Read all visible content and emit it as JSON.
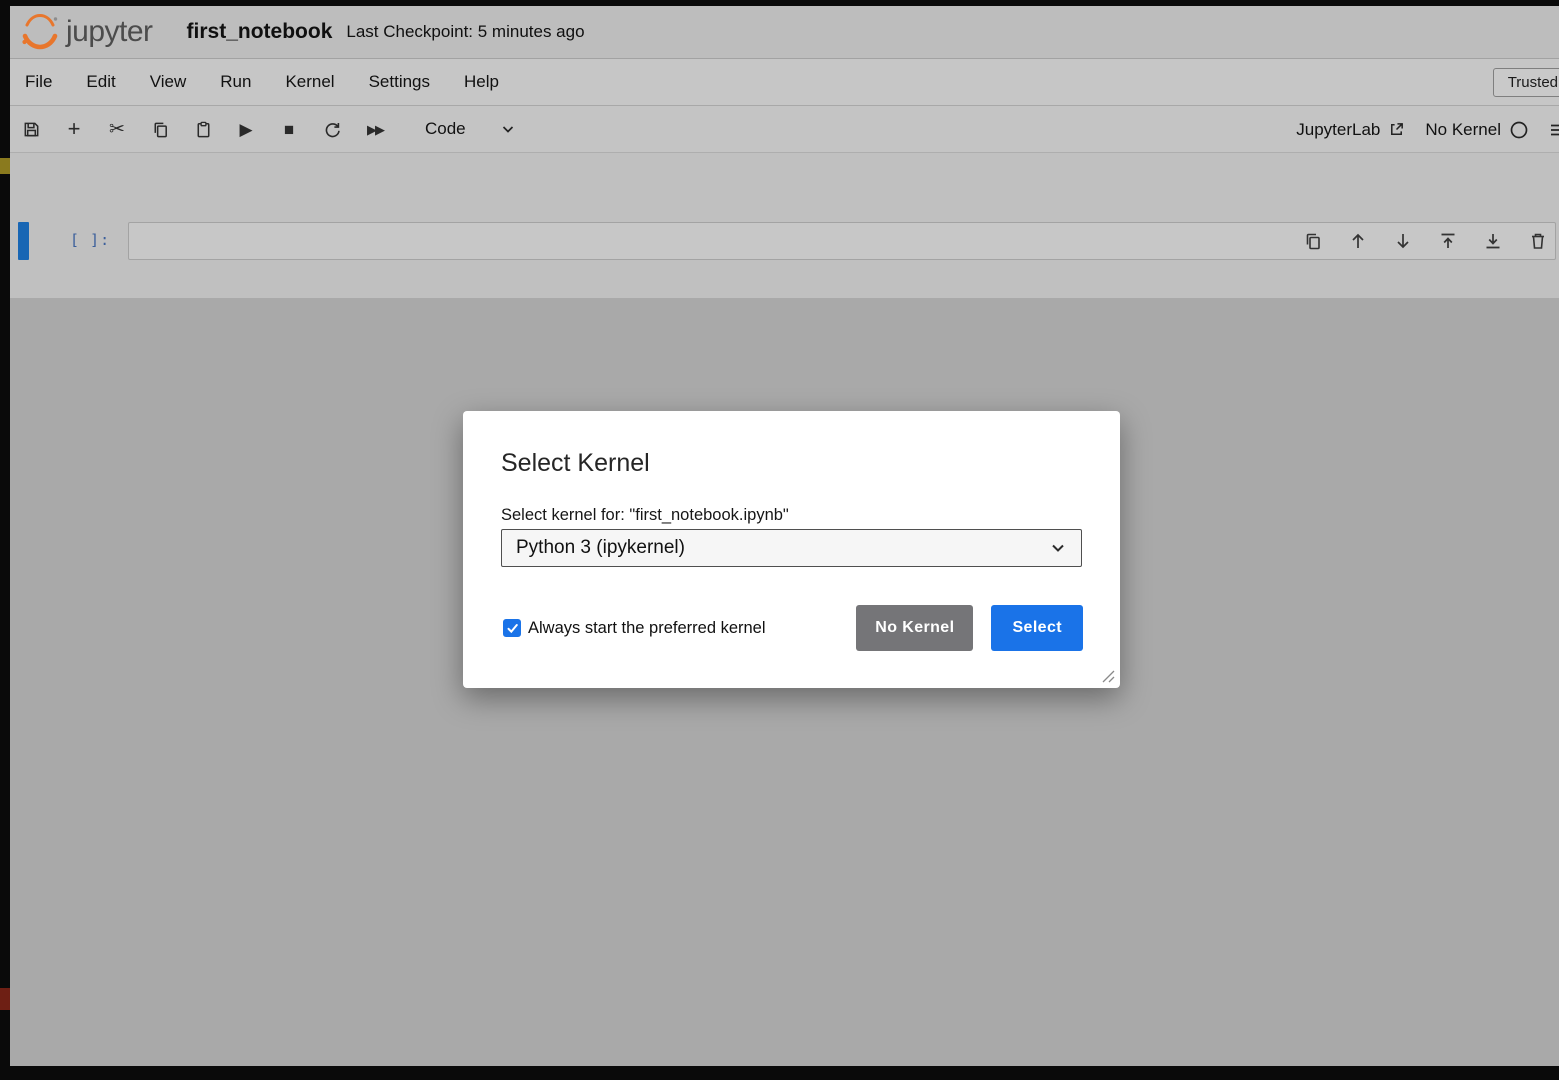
{
  "titlebar": {
    "logo_text": "jupyter",
    "notebook_title": "first_notebook",
    "checkpoint": "Last Checkpoint: 5 minutes ago"
  },
  "menu": {
    "items": [
      "File",
      "Edit",
      "View",
      "Run",
      "Kernel",
      "Settings",
      "Help"
    ],
    "trusted": "Trusted"
  },
  "toolbar": {
    "cell_type": "Code",
    "jupyterlab": "JupyterLab",
    "kernel_status": "No Kernel"
  },
  "icons": {
    "add": "+",
    "cut": "✂",
    "run": "▶",
    "stop": "■",
    "fast_forward": "▶▶"
  },
  "cell": {
    "prompt": "[ ]:"
  },
  "dialog": {
    "title": "Select Kernel",
    "prompt_label": "Select kernel for: \"first_notebook.ipynb\"",
    "kernel_dropdown_value": "Python 3 (ipykernel)",
    "checkbox_label": "Always start the preferred kernel",
    "buttons": {
      "no_kernel": "No Kernel",
      "select": "Select"
    }
  },
  "colors": {
    "accent_blue": "#1a73e8",
    "button_gray": "#757578",
    "jupyter_orange": "#e8762c",
    "cell_focus_blue": "#1866b4"
  }
}
